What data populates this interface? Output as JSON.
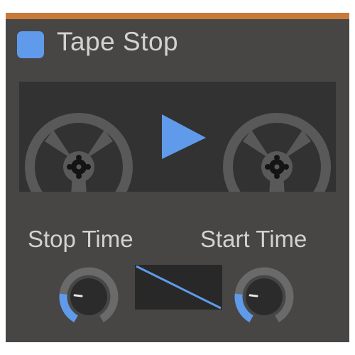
{
  "plugin": {
    "title": "Tape Stop",
    "accent_color": "#5f9bea",
    "header_bar_color": "#c77a3a",
    "panel_color": "#474645",
    "power_enabled": true
  },
  "display": {
    "play_icon": "play-icon",
    "left_reel_icon": "tape-reel-icon",
    "right_reel_icon": "tape-reel-icon"
  },
  "controls": {
    "stop_time": {
      "label": "Stop Time",
      "value_fraction": 0.22
    },
    "start_time": {
      "label": "Start Time",
      "value_fraction": 0.22
    },
    "curve_preview": {
      "shape": "linear-descending"
    }
  }
}
